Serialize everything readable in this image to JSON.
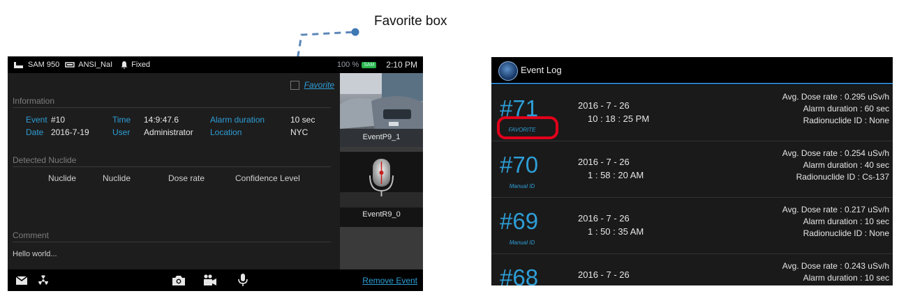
{
  "annotation": {
    "label": "Favorite box"
  },
  "left_screen": {
    "status": {
      "device": "SAM 950",
      "detector": "ANSI_NaI",
      "mode": "Fixed",
      "battery_pct": "100 %",
      "battery_badge": "SAM",
      "time": "2:10 PM"
    },
    "favorite": {
      "label": "Favorite",
      "checked": false
    },
    "information": {
      "title": "Information",
      "event_label": "Event",
      "event_value": "#10",
      "time_label": "Time",
      "time_value": "14:9:47.6",
      "alarm_label": "Alarm duration",
      "alarm_value": "10 sec",
      "date_label": "Date",
      "date_value": "2016-7-19",
      "user_label": "User",
      "user_value": "Administrator",
      "location_label": "Location",
      "location_value": "NYC"
    },
    "detected_nuclide": {
      "title": "Detected Nuclide",
      "columns": [
        "Nuclide",
        "Nuclide",
        "Dose rate",
        "Confidence Level"
      ]
    },
    "comment": {
      "title": "Comment",
      "text": "Hello world..."
    },
    "thumbnails": [
      {
        "label": "EventP9_1",
        "kind": "photo"
      },
      {
        "label": "EventR9_0",
        "kind": "audio"
      }
    ],
    "bottom_bar": {
      "remove_label": "Remove Event"
    }
  },
  "right_screen": {
    "header": {
      "title": "Event Log"
    },
    "events": [
      {
        "number": "#71",
        "tag": "FAVORITE",
        "date": "2016 - 7 - 26",
        "time": "10 : 18 : 25 PM",
        "dose": "Avg. Dose rate : 0.295 uSv/h",
        "alarm": "Alarm duration : 60 sec",
        "nuclide": "Radionuclide ID : None"
      },
      {
        "number": "#70",
        "tag": "Manual ID",
        "date": "2016 - 7 - 26",
        "time": "1 : 58 : 20 AM",
        "dose": "Avg. Dose rate : 0.254 uSv/h",
        "alarm": "Alarm duration : 40 sec",
        "nuclide": "Radionuclide ID : Cs-137"
      },
      {
        "number": "#69",
        "tag": "Manual ID",
        "date": "2016 - 7 - 26",
        "time": "1 : 50 : 35 AM",
        "dose": "Avg. Dose rate : 0.217 uSv/h",
        "alarm": "Alarm duration : 10 sec",
        "nuclide": "Radionuclide ID : None"
      },
      {
        "number": "#68",
        "tag": "",
        "date": "2016 - 7 - 26",
        "time": "",
        "dose": "Avg. Dose rate : 0.243 uSv/h",
        "alarm": "Alarm duration : 10 sec",
        "nuclide": ""
      }
    ]
  },
  "colors": {
    "accent": "#2e9ed6",
    "highlight": "#e1001a",
    "battery": "#29b34a"
  },
  "icons": [
    "box-icon",
    "nai-icon",
    "bell-icon",
    "mail-icon",
    "radiation-icon",
    "camera-icon",
    "video-icon",
    "microphone-icon",
    "event-log-logo-icon"
  ]
}
